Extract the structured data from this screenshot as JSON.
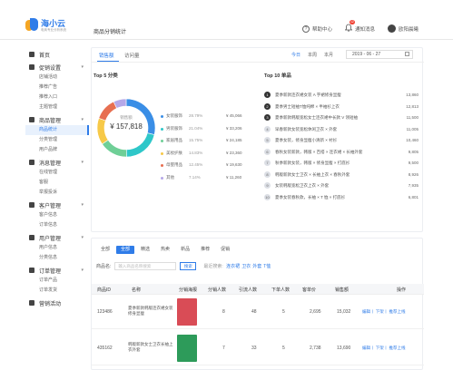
{
  "brand": {
    "title": "海小云",
    "subtitle": "电商专业分析系统"
  },
  "header": {
    "page_title": "商品分销统计",
    "help_label": "帮助中心",
    "notice_label": "通知消息",
    "notice_badge": "12",
    "user_name": "欧阳晨曦"
  },
  "sidebar": {
    "groups": [
      {
        "label": "首页",
        "icon": "home-icon",
        "items": []
      },
      {
        "label": "促销设置",
        "icon": "promo-icon",
        "items": [
          "店铺活动",
          "推荐广告",
          "推荐入口",
          "主题管理"
        ]
      },
      {
        "label": "商品管理",
        "icon": "goods-icon",
        "items": [
          "商品统计",
          "分类管理",
          "用户品牌"
        ]
      },
      {
        "label": "消息管理",
        "icon": "message-icon",
        "items": [
          "在线管理",
          "客服",
          "举报投诉"
        ]
      },
      {
        "label": "客户管理",
        "icon": "customer-icon",
        "items": [
          "客户信息",
          "订单信息"
        ]
      },
      {
        "label": "用户管理",
        "icon": "user-icon",
        "items": [
          "用户信息",
          "分类信息"
        ]
      },
      {
        "label": "订单管理",
        "icon": "order-icon",
        "items": [
          "订单产品",
          "订单发货"
        ]
      },
      {
        "label": "营销活动",
        "icon": "campaign-icon",
        "items": []
      }
    ],
    "active_item": "商品统计"
  },
  "overview": {
    "tabs": [
      "销售额",
      "访问量"
    ],
    "active_tab": "销售额",
    "ranges": [
      "今日",
      "本周",
      "本月"
    ],
    "active_range": "今日",
    "date": "2019 - 06 - 27"
  },
  "top5": {
    "title": "Top 5 分类",
    "center_label": "销售额",
    "center_value": "¥ 157,818"
  },
  "top10": {
    "title": "Top 10 单品",
    "items": [
      {
        "rank": "1",
        "name": "夏季新款连衣裙女装 A 字裙修身显瘦",
        "value": "13,860"
      },
      {
        "rank": "2",
        "name": "夏季男士短袖T恤纯棉 × 半袖衫上衣",
        "value": "12,813"
      },
      {
        "rank": "3",
        "name": "夏季新款韩版宽松女士连衣裙中长款 V 领短袖",
        "value": "11,500"
      },
      {
        "rank": "4",
        "name": "早春新款女装宽松休闲卫衣 × 外套",
        "value": "11,005"
      },
      {
        "rank": "5",
        "name": "夏季女装，修身显瘦小清新 × 衬衫",
        "value": "10,460"
      },
      {
        "rank": "6",
        "name": "春秋女装新款，韩版 × 百搭 × 连衣裙 × 长袖外套",
        "value": "9,805"
      },
      {
        "rank": "7",
        "name": "秋季新款女装，韩版 × 修身显瘦 × 打底衫",
        "value": "9,500"
      },
      {
        "rank": "8",
        "name": "韩版新款女士卫衣 × 长袖上衣 × 春秋外套",
        "value": "8,926"
      },
      {
        "rank": "9",
        "name": "女装韩版宽松卫衣上衣 × 外套",
        "value": "7,935"
      },
      {
        "rank": "10",
        "name": "夏季女装春秋款，长袖 × T 恤 × 打底衫",
        "value": "6,801"
      }
    ]
  },
  "chart_data": {
    "type": "pie",
    "title": "Top 5 分类",
    "categories": [
      "女装服饰",
      "男装服饰",
      "家居用品",
      "美妆护肤",
      "母婴用品",
      "其他"
    ],
    "values": [
      28.79,
      21.04,
      15.75,
      14.83,
      12.45,
      7.14
    ],
    "amounts": [
      "¥ 45,066",
      "¥ 33,206",
      "¥ 24,185",
      "¥ 23,360",
      "¥ 19,630",
      "¥ 11,260"
    ],
    "colors": [
      "#3a8ee6",
      "#2ec7c9",
      "#6fcf97",
      "#f7c948",
      "#e76f51",
      "#b5a8e8"
    ],
    "legend": "right"
  },
  "goods_table": {
    "filters": [
      "全部",
      "全部",
      "精选",
      "热卖",
      "新品",
      "推荐",
      "促销"
    ],
    "active_filter": 1,
    "search_label": "商品名:",
    "search_placeholder": "输入商品名称搜索",
    "search_button": "搜索",
    "hint_label": "最近搜索:",
    "hint_keywords": [
      "连衣裙",
      "卫衣",
      "外套",
      "T恤"
    ],
    "columns": [
      "商品ID",
      "名称",
      "分销海报",
      "分销人数",
      "引流人数",
      "下单人数",
      "客单价",
      "销售额",
      "操作"
    ],
    "rows": [
      {
        "id": "123486",
        "name": "夏季新款韩版连衣裙女装修身显瘦",
        "poster_color": "#d94c56",
        "distributors": "8",
        "traffic": "48",
        "orders": "5",
        "unit_price": "2,695",
        "sales": "15,032",
        "actions": "编辑丨 下架丨 推荐上线"
      },
      {
        "id": "435162",
        "name": "韩版新款女士卫衣长袖上衣外套",
        "poster_color": "#2d9b5a",
        "distributors": "7",
        "traffic": "33",
        "orders": "5",
        "unit_price": "2,738",
        "sales": "13,690",
        "actions": "编辑丨 下架丨 推荐上线"
      }
    ]
  }
}
